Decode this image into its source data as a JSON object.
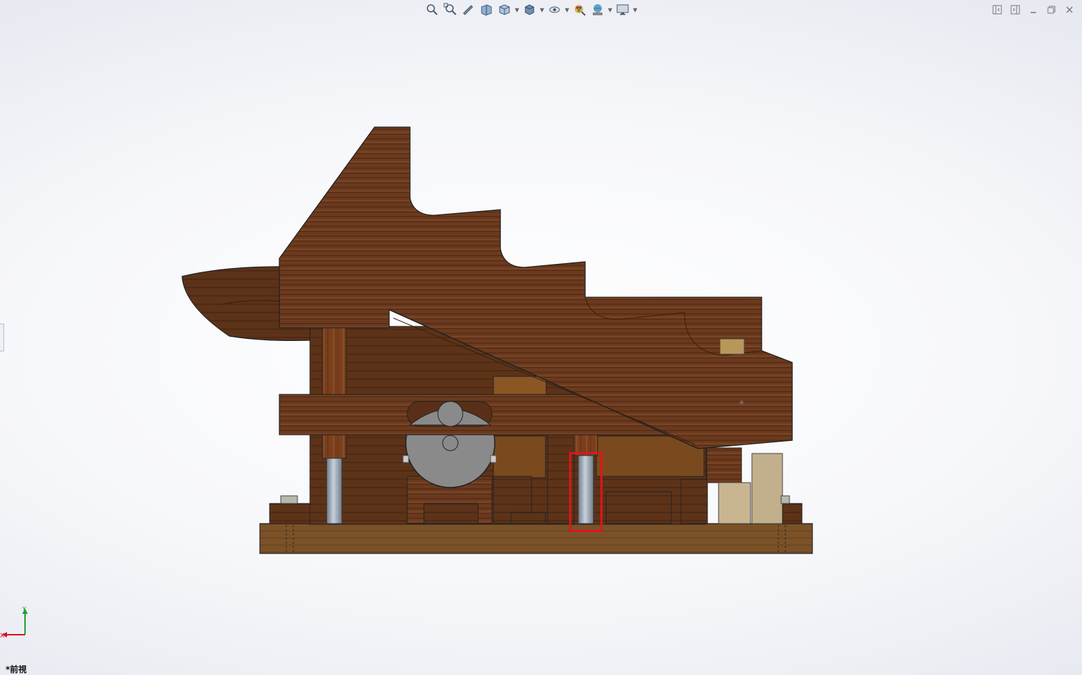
{
  "view": {
    "name": "*前視"
  },
  "heads_up_toolbar": {
    "items": [
      "zoom-to-fit-icon",
      "zoom-to-area-icon",
      "previous-view-icon",
      "section-view-icon",
      "view-orientation-icon",
      "display-style-icon",
      "hide-show-items-icon",
      "edit-appearance-icon",
      "apply-scene-icon",
      "view-settings-icon"
    ]
  },
  "window_controls": {
    "items": [
      "tile-left-icon",
      "tile-right-icon",
      "minimize-icon",
      "restore-icon",
      "close-icon"
    ]
  },
  "triad": {
    "x_label": "X",
    "y_label": "Y",
    "x_color": "#d01020",
    "y_color": "#20a030"
  },
  "colors": {
    "wood_dark": "#5a2f17",
    "wood_mid": "#7a4526",
    "wood_light": "#8c5a34",
    "base_wood": "#7b5228",
    "steel": "#8e9aa6",
    "disc": "#8a8a8a",
    "highlight": "#e0141c"
  }
}
